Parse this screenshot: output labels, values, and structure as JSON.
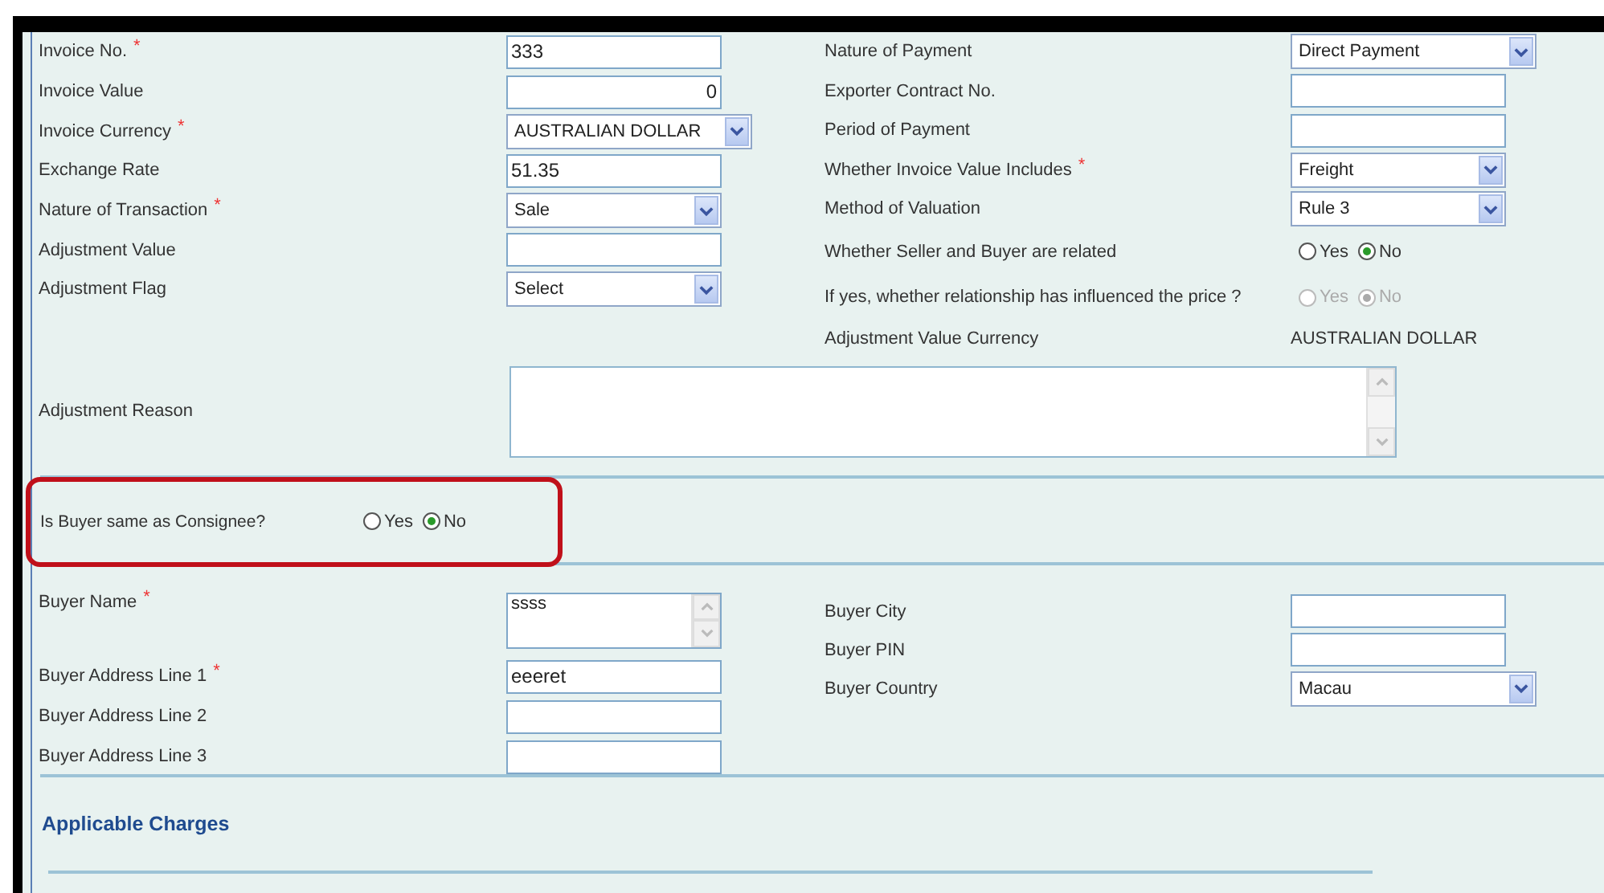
{
  "invoice_fields": [
    {
      "label": "Invoice No.",
      "marker": "*",
      "kind": "text",
      "value": "333"
    },
    {
      "label": "Invoice Value",
      "kind": "number",
      "value": "0"
    },
    {
      "label": "Invoice Currency",
      "marker": "*",
      "kind": "wide-select",
      "value": "AUSTRALIAN DOLLAR"
    },
    {
      "label": "Exchange Rate",
      "kind": "text",
      "value": "51.35"
    },
    {
      "label": "Nature of Transaction",
      "marker": "*",
      "kind": "select",
      "value": "Sale"
    },
    {
      "label": "Adjustment Value",
      "kind": "text"
    },
    {
      "label": "Adjustment Flag",
      "kind": "select",
      "value": "Select"
    }
  ],
  "payment_fields": [
    {
      "label": "Nature of Payment",
      "kind": "wide-select",
      "value": "Direct Payment"
    },
    {
      "label": "Exporter Contract No.",
      "kind": "text"
    },
    {
      "label": "Period of Payment",
      "kind": "text"
    },
    {
      "label": "Whether Invoice Value Includes",
      "marker": "*",
      "kind": "select",
      "value": "Freight"
    },
    {
      "label": "Method of Valuation",
      "kind": "select",
      "value": "Rule 3"
    },
    {
      "label": "Whether Seller and Buyer are related",
      "kind": "radio",
      "disabled": false,
      "options": [
        {
          "label": "Yes",
          "selected": false
        },
        {
          "label": "No",
          "selected": true
        }
      ]
    },
    {
      "label": "If yes, whether relationship has influenced the price ?",
      "kind": "radio",
      "disabled": true,
      "options": [
        {
          "label": "Yes",
          "selected": false
        },
        {
          "label": "No",
          "selected": true
        }
      ]
    },
    {
      "label": "Adjustment Value Currency",
      "kind": "static",
      "value": "AUSTRALIAN DOLLAR"
    }
  ],
  "adjustment_reason": {
    "label": "Adjustment Reason"
  },
  "consignee_question": {
    "label": "Is Buyer same as Consignee?",
    "highlighted": true,
    "options": [
      {
        "label": "Yes",
        "selected": false
      },
      {
        "label": "No",
        "selected": true
      }
    ]
  },
  "buyer_fields": [
    {
      "label": "Buyer Name",
      "marker": "*",
      "kind": "textarea",
      "value": "ssss"
    },
    {
      "label": "Buyer Address Line 1",
      "marker": "*",
      "kind": "text",
      "value": "eeeret"
    },
    {
      "label": "Buyer Address Line 2",
      "kind": "text"
    },
    {
      "label": "Buyer Address Line 3",
      "kind": "text"
    }
  ],
  "buyer_location_fields": [
    {
      "label": "Buyer City",
      "kind": "text"
    },
    {
      "label": "Buyer PIN",
      "kind": "text"
    },
    {
      "label": "Buyer Country",
      "kind": "wide-select",
      "value": "Macau"
    }
  ],
  "charges_heading": "Applicable Charges"
}
